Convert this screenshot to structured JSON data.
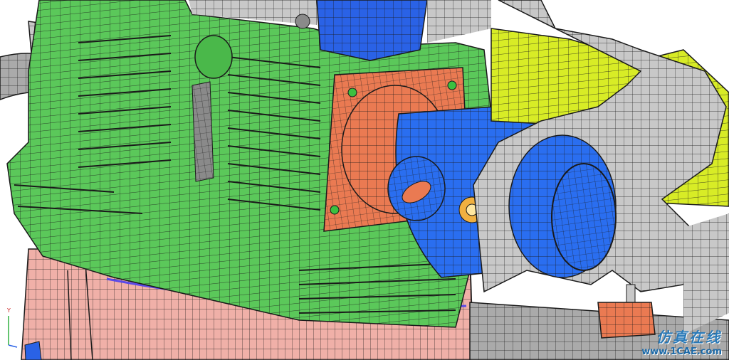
{
  "scene": {
    "subject": "engine-cylinder-fe-mesh",
    "colors": {
      "cylinder_head": "#5bc85a",
      "cylinder_barrel": "#f0b0a8",
      "intake_flange": "#ea7a52",
      "intake_pipe": "#2a6ef0",
      "top_block": "#2a62e6",
      "manifold": "#d8ec26",
      "bracket": "#c8c8c8",
      "exhaust_pipe": "#aaaaaa",
      "mesh_line": "#1a1a1a",
      "bottom_part": "#ea7a52",
      "orange_ring": "#f0b040"
    }
  },
  "triad": {
    "y_label": "Y"
  },
  "watermark": {
    "cn_text": "仿真在线",
    "url_text": "www.1CAE.com"
  }
}
